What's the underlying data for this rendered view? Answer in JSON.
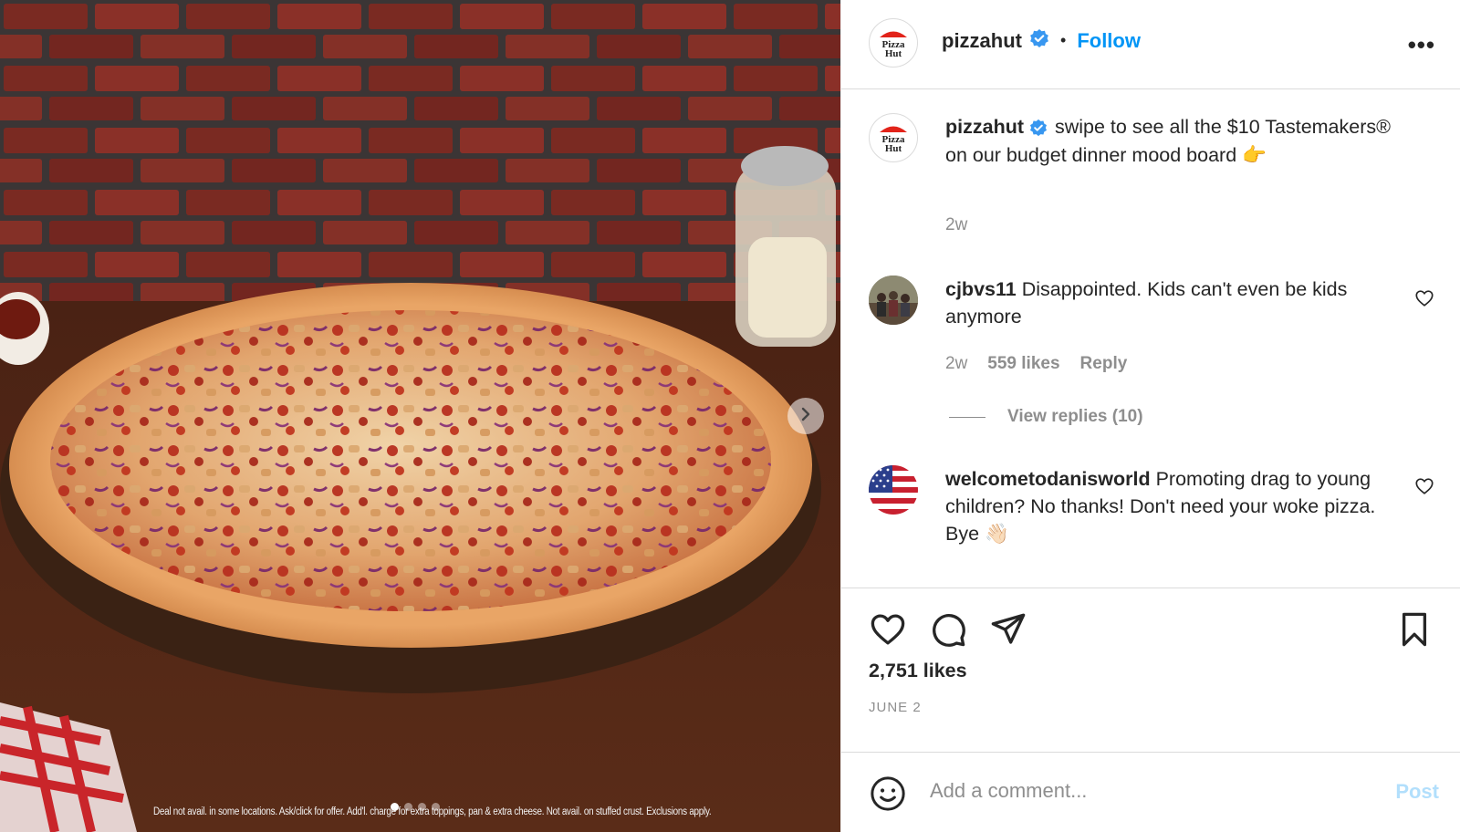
{
  "header": {
    "username": "pizzahut",
    "separator": "•",
    "follow_label": "Follow",
    "more_label": "•••",
    "avatar_icon": "pizza-hut-logo"
  },
  "caption": {
    "username": "pizzahut",
    "text": " swipe to see all the $10 Tastemakers® on our budget dinner mood board 👉",
    "time": "2w"
  },
  "comments": [
    {
      "username": "cjbvs11",
      "text": " Disappointed. Kids can't even be kids anymore",
      "time": "2w",
      "likes": "559 likes",
      "reply_label": "Reply",
      "view_replies": "View replies (10)"
    },
    {
      "username": "welcometodanisworld",
      "text": " Promoting drag to young children? No thanks! Don't need your woke pizza. Bye 👋🏻"
    }
  ],
  "actions": {
    "likes": "2,751 likes",
    "date": "JUNE 2"
  },
  "composer": {
    "placeholder": "Add a comment...",
    "post_label": "Post"
  },
  "media": {
    "disclaimer": "Deal not avail. in some locations. Ask/click for offer. Add'l. charge for extra toppings, pan & extra cheese. Not avail. on stuffed crust. Exclusions apply.",
    "carousel_total": 4,
    "carousel_active": 1
  },
  "colors": {
    "accent": "#0095f6",
    "post_disabled": "#b2dffc",
    "secondary_text": "#8e8e8e",
    "pizza_hut_red": "#e2231a"
  }
}
